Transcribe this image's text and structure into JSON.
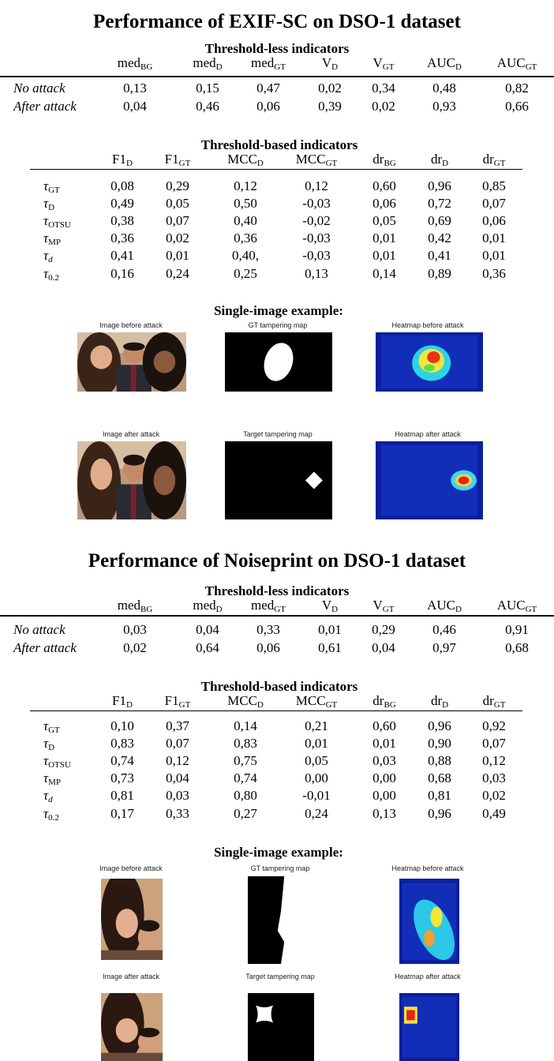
{
  "sections": [
    {
      "title": "Performance of EXIF-SC on DSO-1 dataset",
      "less_heading": "Threshold-less indicators",
      "less_headers": [
        {
          "base": "med",
          "sub": "BG"
        },
        {
          "base": "med",
          "sub": "D"
        },
        {
          "base": "med",
          "sub": "GT"
        },
        {
          "base": "V",
          "sub": "D"
        },
        {
          "base": "V",
          "sub": "GT"
        },
        {
          "base": "AUC",
          "sub": "D"
        },
        {
          "base": "AUC",
          "sub": "GT"
        }
      ],
      "less_rows": [
        {
          "label": "No attack",
          "values": [
            "0,13",
            "0,15",
            "0,47",
            "0,02",
            "0,34",
            "0,48",
            "0,82"
          ]
        },
        {
          "label": "After attack",
          "values": [
            "0,04",
            "0,46",
            "0,06",
            "0,39",
            "0,02",
            "0,93",
            "0,66"
          ]
        }
      ],
      "based_heading": "Threshold-based indicators",
      "based_headers": [
        {
          "base": "F1",
          "sub": "D"
        },
        {
          "base": "F1",
          "sub": "GT"
        },
        {
          "base": "MCC",
          "sub": "D"
        },
        {
          "base": "MCC",
          "sub": "GT"
        },
        {
          "base": "dr",
          "sub": "BG"
        },
        {
          "base": "dr",
          "sub": "D"
        },
        {
          "base": "dr",
          "sub": "GT"
        }
      ],
      "based_rows": [
        {
          "sym": "τ",
          "sub": "GT",
          "italic_sub": false,
          "values": [
            "0,08",
            "0,29",
            "0,12",
            "0,12",
            "0,60",
            "0,96",
            "0,85"
          ]
        },
        {
          "sym": "τ",
          "sub": "D",
          "italic_sub": false,
          "values": [
            "0,49",
            "0,05",
            "0,50",
            "-0,03",
            "0,06",
            "0,72",
            "0,07"
          ]
        },
        {
          "sym": "τ",
          "sub": "OTSU",
          "italic_sub": false,
          "values": [
            "0,38",
            "0,07",
            "0,40",
            "-0,02",
            "0,05",
            "0,69",
            "0,06"
          ]
        },
        {
          "sym": "τ",
          "sub": "MP",
          "italic_sub": false,
          "values": [
            "0,36",
            "0,02",
            "0,36",
            "-0,03",
            "0,01",
            "0,42",
            "0,01"
          ]
        },
        {
          "sym": "τ",
          "sub": "d",
          "italic_sub": true,
          "values": [
            "0,41",
            "0,01",
            "0,40,",
            "-0,03",
            "0,01",
            "0,41",
            "0,01"
          ]
        },
        {
          "sym": "τ",
          "sub": "0.2",
          "italic_sub": false,
          "values": [
            "0,16",
            "0,24",
            "0,25",
            "0,13",
            "0,14",
            "0,89",
            "0,36"
          ]
        }
      ],
      "example_heading": "Single-image example:",
      "captions": [
        "Image before attack",
        "GT tampering map",
        "Heatmap before attack",
        "Image after attack",
        "Target tampering map",
        "Heatmap after attack"
      ]
    },
    {
      "title": "Performance of Noiseprint on DSO-1 dataset",
      "less_heading": "Threshold-less indicators",
      "less_headers": [
        {
          "base": "med",
          "sub": "BG"
        },
        {
          "base": "med",
          "sub": "D"
        },
        {
          "base": "med",
          "sub": "GT"
        },
        {
          "base": "V",
          "sub": "D"
        },
        {
          "base": "V",
          "sub": "GT"
        },
        {
          "base": "AUC",
          "sub": "D"
        },
        {
          "base": "AUC",
          "sub": "GT"
        }
      ],
      "less_rows": [
        {
          "label": "No attack",
          "values": [
            "0,03",
            "0,04",
            "0,33",
            "0,01",
            "0,29",
            "0,46",
            "0,91"
          ]
        },
        {
          "label": "After attack",
          "values": [
            "0,02",
            "0,64",
            "0,06",
            "0,61",
            "0,04",
            "0,97",
            "0,68"
          ]
        }
      ],
      "based_heading": "Threshold-based indicators",
      "based_headers": [
        {
          "base": "F1",
          "sub": "D"
        },
        {
          "base": "F1",
          "sub": "GT"
        },
        {
          "base": "MCC",
          "sub": "D"
        },
        {
          "base": "MCC",
          "sub": "GT"
        },
        {
          "base": "dr",
          "sub": "BG"
        },
        {
          "base": "dr",
          "sub": "D"
        },
        {
          "base": "dr",
          "sub": "GT"
        }
      ],
      "based_rows": [
        {
          "sym": "τ",
          "sub": "GT",
          "italic_sub": false,
          "values": [
            "0,10",
            "0,37",
            "0,14",
            "0,21",
            "0,60",
            "0,96",
            "0,92"
          ]
        },
        {
          "sym": "τ",
          "sub": "D",
          "italic_sub": false,
          "values": [
            "0,83",
            "0,07",
            "0,83",
            "0,01",
            "0,01",
            "0,90",
            "0,07"
          ]
        },
        {
          "sym": "τ",
          "sub": "OTSU",
          "italic_sub": false,
          "values": [
            "0,74",
            "0,12",
            "0,75",
            "0,05",
            "0,03",
            "0,88",
            "0,12"
          ]
        },
        {
          "sym": "τ",
          "sub": "MP",
          "italic_sub": false,
          "values": [
            "0,73",
            "0,04",
            "0,74",
            "0,00",
            "0,00",
            "0,68",
            "0,03"
          ]
        },
        {
          "sym": "τ",
          "sub": "d",
          "italic_sub": true,
          "values": [
            "0,81",
            "0,03",
            "0,80",
            "-0,01",
            "0,00",
            "0,81",
            "0,02"
          ]
        },
        {
          "sym": "τ",
          "sub": "0.2",
          "italic_sub": false,
          "values": [
            "0,17",
            "0,33",
            "0,27",
            "0,24",
            "0,13",
            "0,96",
            "0,49"
          ]
        }
      ],
      "example_heading": "Single-image example:",
      "captions": [
        "Image before attack",
        "GT tampering map",
        "Heatmap before attack",
        "Image after attack",
        "Target tampering map",
        "Heatmap after attack"
      ]
    }
  ]
}
